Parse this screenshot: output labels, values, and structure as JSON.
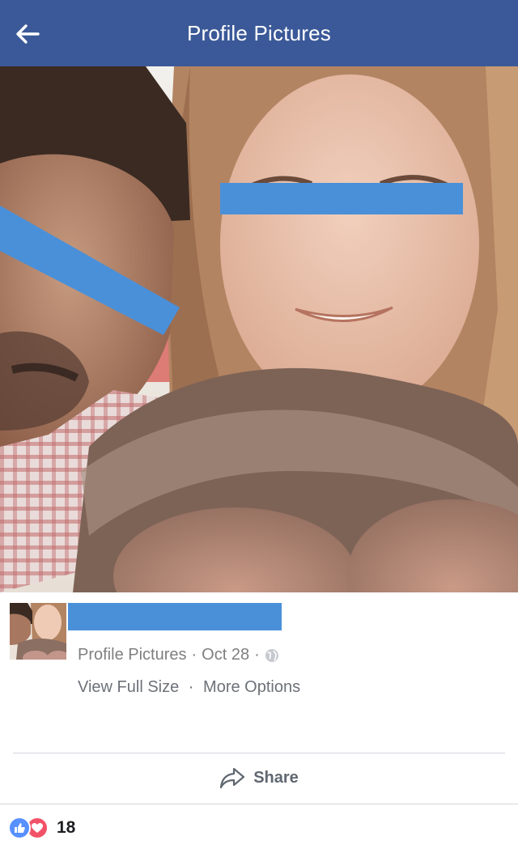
{
  "navbar": {
    "title": "Profile Pictures",
    "back_icon": "arrow-left-icon",
    "background": "#3b5998"
  },
  "photo": {
    "redaction_color": "#4a90d9"
  },
  "post_meta": {
    "album": "Profile Pictures",
    "separator": "·",
    "date": "Oct 28",
    "privacy_icon": "globe-icon",
    "view_full_size": "View Full Size",
    "more_options": "More Options"
  },
  "share": {
    "label": "Share",
    "icon": "share-arrow-icon"
  },
  "reactions": {
    "count": "18",
    "icons": [
      "like-icon",
      "love-icon"
    ],
    "like_color": "#5890ff",
    "love_color": "#f25268"
  }
}
